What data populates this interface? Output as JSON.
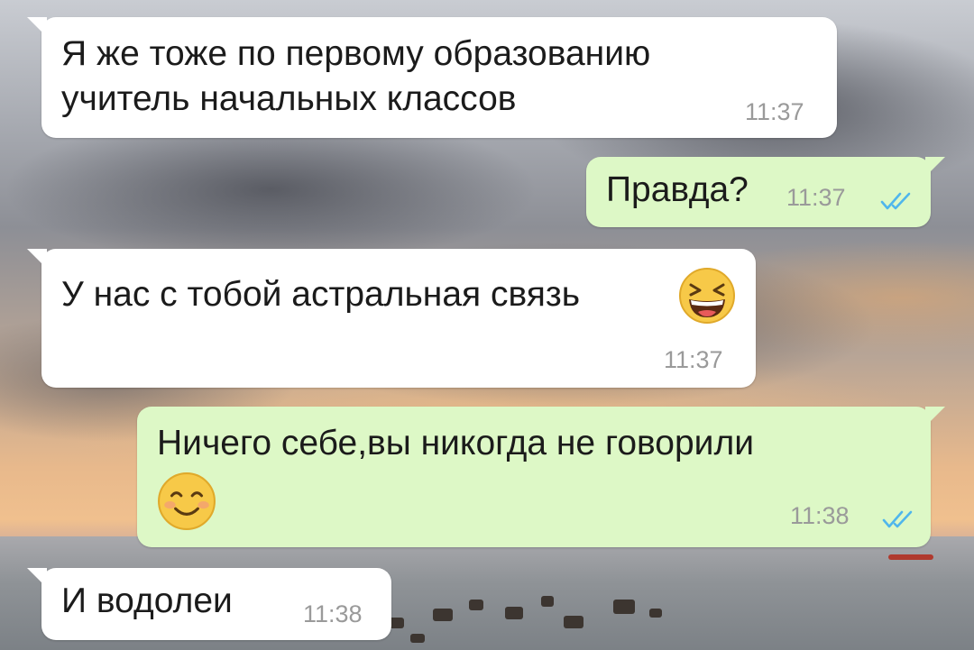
{
  "chat": {
    "messages": [
      {
        "direction": "incoming",
        "text_line1": "Я же тоже по первому образованию",
        "text_line2": "учитель начальных классов",
        "time": "11:37"
      },
      {
        "direction": "outgoing",
        "text": "Правда?",
        "time": "11:37",
        "status": "read"
      },
      {
        "direction": "incoming",
        "text": "У нас с тобой астральная связь",
        "emoji": "grinning-squinting-face",
        "time": "11:37"
      },
      {
        "direction": "outgoing",
        "text": "Ничего себе,вы никогда не говорили",
        "emoji": "smiling-face-with-smiling-eyes",
        "time": "11:38",
        "status": "read"
      },
      {
        "direction": "incoming",
        "text": "И водолеи",
        "time": "11:38"
      }
    ]
  },
  "colors": {
    "incoming_bubble": "#ffffff",
    "outgoing_bubble": "#ddf8c6",
    "read_ticks": "#4fb6ec",
    "timestamp": "#9a9a9a"
  }
}
